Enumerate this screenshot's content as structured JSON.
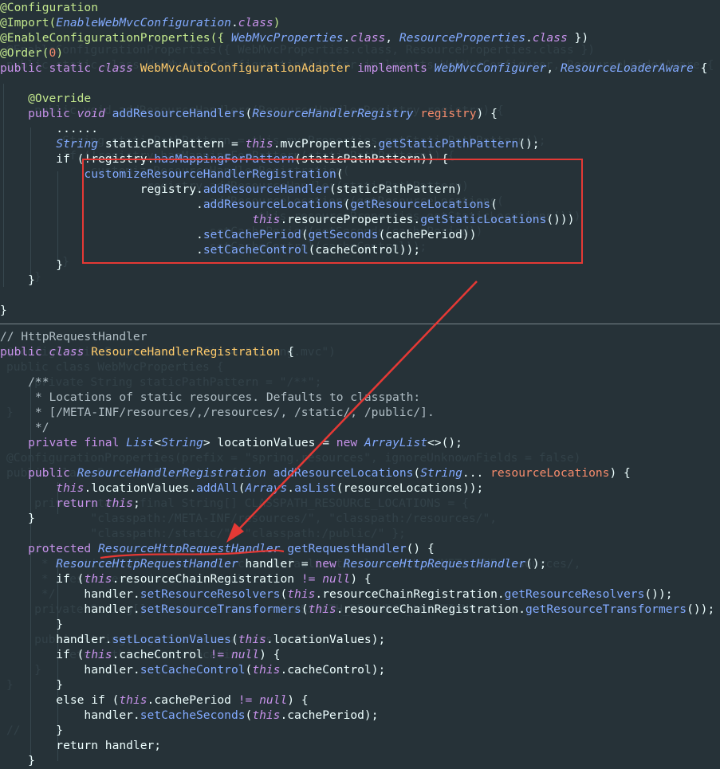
{
  "editor": {
    "top_pane": [
      [
        {
          "t": "@Configuration",
          "c": "annotation"
        }
      ],
      [
        {
          "t": "@Import(",
          "c": "annotation"
        },
        {
          "t": "EnableWebMvcConfiguration",
          "c": "type"
        },
        {
          "t": ".",
          "c": "default"
        },
        {
          "t": "class",
          "c": "italic"
        },
        {
          "t": ")",
          "c": "annotation"
        }
      ],
      [
        {
          "t": "@EnableConfigurationProperties({ ",
          "c": "annotation"
        },
        {
          "t": "WebMvcProperties",
          "c": "type"
        },
        {
          "t": ".",
          "c": "default"
        },
        {
          "t": "class",
          "c": "italic"
        },
        {
          "t": ", ",
          "c": "default"
        },
        {
          "t": "ResourceProperties",
          "c": "type"
        },
        {
          "t": ".",
          "c": "default"
        },
        {
          "t": "class",
          "c": "italic"
        },
        {
          "t": " })",
          "c": "default"
        }
      ],
      [
        {
          "t": "@Order(",
          "c": "annotation"
        },
        {
          "t": "0",
          "c": "number"
        },
        {
          "t": ")",
          "c": "annotation"
        }
      ],
      [
        {
          "t": "public static ",
          "c": "keyword"
        },
        {
          "t": "class ",
          "c": "italic"
        },
        {
          "t": "WebMvcAutoConfigurationAdapter ",
          "c": "class"
        },
        {
          "t": "implements ",
          "c": "keyword"
        },
        {
          "t": "WebMvcConfigurer",
          "c": "type"
        },
        {
          "t": ", ",
          "c": "default"
        },
        {
          "t": "ResourceLoaderAware ",
          "c": "type"
        },
        {
          "t": "{",
          "c": "default"
        }
      ],
      [],
      [
        {
          "t": "    @Override",
          "c": "annotation"
        }
      ],
      [
        {
          "t": "    public ",
          "c": "keyword"
        },
        {
          "t": "void ",
          "c": "italic"
        },
        {
          "t": "addResourceHandlers",
          "c": "method"
        },
        {
          "t": "(",
          "c": "default"
        },
        {
          "t": "ResourceHandlerRegistry ",
          "c": "type"
        },
        {
          "t": "registry",
          "c": "param"
        },
        {
          "t": ") {",
          "c": "default"
        }
      ],
      [
        {
          "t": "        ......",
          "c": "default"
        }
      ],
      [
        {
          "t": "        ",
          "c": "default"
        },
        {
          "t": "String ",
          "c": "type"
        },
        {
          "t": "staticPathPattern = ",
          "c": "default"
        },
        {
          "t": "this",
          "c": "italic"
        },
        {
          "t": ".mvcProperties.",
          "c": "default"
        },
        {
          "t": "getStaticPathPattern",
          "c": "method"
        },
        {
          "t": "();",
          "c": "default"
        }
      ],
      [
        {
          "t": "        if (!registry.",
          "c": "default"
        },
        {
          "t": "hasMappingForPattern",
          "c": "method"
        },
        {
          "t": "(staticPathPattern)) {",
          "c": "default"
        }
      ],
      [
        {
          "t": "            customizeResourceHandlerRegistration",
          "c": "method"
        },
        {
          "t": "(",
          "c": "default"
        }
      ],
      [
        {
          "t": "                    registry.",
          "c": "default"
        },
        {
          "t": "addResourceHandler",
          "c": "method"
        },
        {
          "t": "(staticPathPattern)",
          "c": "default"
        }
      ],
      [
        {
          "t": "                            .",
          "c": "default"
        },
        {
          "t": "addResourceLocations",
          "c": "method"
        },
        {
          "t": "(",
          "c": "default"
        },
        {
          "t": "getResourceLocations",
          "c": "method"
        },
        {
          "t": "(",
          "c": "default"
        }
      ],
      [
        {
          "t": "                                    ",
          "c": "default"
        },
        {
          "t": "this",
          "c": "italic"
        },
        {
          "t": ".resourceProperties.",
          "c": "default"
        },
        {
          "t": "getStaticLocations",
          "c": "method"
        },
        {
          "t": "()))",
          "c": "default"
        }
      ],
      [
        {
          "t": "                            .",
          "c": "default"
        },
        {
          "t": "setCachePeriod",
          "c": "method"
        },
        {
          "t": "(",
          "c": "default"
        },
        {
          "t": "getSeconds",
          "c": "method"
        },
        {
          "t": "(cachePeriod))",
          "c": "default"
        }
      ],
      [
        {
          "t": "                            .",
          "c": "default"
        },
        {
          "t": "setCacheControl",
          "c": "method"
        },
        {
          "t": "(cacheControl));",
          "c": "default"
        }
      ],
      [
        {
          "t": "        }",
          "c": "default"
        }
      ],
      [
        {
          "t": "    }",
          "c": "default"
        }
      ],
      [],
      [
        {
          "t": "}",
          "c": "default"
        }
      ]
    ],
    "bottom_pane": [
      [
        {
          "t": "// HttpRequestHandler",
          "c": "comment"
        }
      ],
      [
        {
          "t": "public ",
          "c": "keyword"
        },
        {
          "t": "class ",
          "c": "italic"
        },
        {
          "t": "ResourceHandlerRegistration ",
          "c": "class"
        },
        {
          "t": "{",
          "c": "default"
        }
      ],
      [],
      [
        {
          "t": "    /**",
          "c": "comment"
        }
      ],
      [
        {
          "t": "     * Locations of static resources. Defaults to classpath:",
          "c": "comment"
        }
      ],
      [
        {
          "t": "     * [/META-INF/resources/,/resources/, /static/, /public/].",
          "c": "comment"
        }
      ],
      [
        {
          "t": "     */",
          "c": "comment"
        }
      ],
      [
        {
          "t": "    private final ",
          "c": "keyword"
        },
        {
          "t": "List",
          "c": "type"
        },
        {
          "t": "<",
          "c": "default"
        },
        {
          "t": "String",
          "c": "type"
        },
        {
          "t": "> ",
          "c": "default"
        },
        {
          "t": "locationValues = ",
          "c": "default"
        },
        {
          "t": "new ",
          "c": "keyword"
        },
        {
          "t": "ArrayList",
          "c": "type"
        },
        {
          "t": "<>();",
          "c": "default"
        }
      ],
      [],
      [
        {
          "t": "    public ",
          "c": "keyword"
        },
        {
          "t": "ResourceHandlerRegistration ",
          "c": "type"
        },
        {
          "t": "addResourceLocations",
          "c": "method"
        },
        {
          "t": "(",
          "c": "default"
        },
        {
          "t": "String",
          "c": "type"
        },
        {
          "t": "... ",
          "c": "default"
        },
        {
          "t": "resourceLocations",
          "c": "param"
        },
        {
          "t": ") {",
          "c": "default"
        }
      ],
      [
        {
          "t": "        ",
          "c": "default"
        },
        {
          "t": "this",
          "c": "italic"
        },
        {
          "t": ".locationValues.",
          "c": "default"
        },
        {
          "t": "addAll",
          "c": "method"
        },
        {
          "t": "(",
          "c": "default"
        },
        {
          "t": "Arrays",
          "c": "type"
        },
        {
          "t": ".",
          "c": "default"
        },
        {
          "t": "asList",
          "c": "method"
        },
        {
          "t": "(resourceLocations));",
          "c": "default"
        }
      ],
      [
        {
          "t": "        return ",
          "c": "keyword"
        },
        {
          "t": "this",
          "c": "italic"
        },
        {
          "t": ";",
          "c": "default"
        }
      ],
      [
        {
          "t": "    }",
          "c": "default"
        }
      ],
      [],
      [
        {
          "t": "    protected ",
          "c": "keyword"
        },
        {
          "t": "ResourceHttpRequestHandler",
          "c": "type"
        },
        {
          "t": " ",
          "c": "default"
        },
        {
          "t": "getRequestHandler",
          "c": "method"
        },
        {
          "t": "() {",
          "c": "default"
        }
      ],
      [
        {
          "t": "        ",
          "c": "default"
        },
        {
          "t": "ResourceHttpRequestHandler ",
          "c": "type"
        },
        {
          "t": "handler = ",
          "c": "default"
        },
        {
          "t": "new ",
          "c": "keyword"
        },
        {
          "t": "ResourceHttpRequestHandler",
          "c": "type"
        },
        {
          "t": "();",
          "c": "default"
        }
      ],
      [
        {
          "t": "        if (",
          "c": "default"
        },
        {
          "t": "this",
          "c": "italic"
        },
        {
          "t": ".resourceChainRegistration ",
          "c": "default"
        },
        {
          "t": "!= ",
          "c": "keyword"
        },
        {
          "t": "null",
          "c": "italic"
        },
        {
          "t": ") {",
          "c": "default"
        }
      ],
      [
        {
          "t": "            handler.",
          "c": "default"
        },
        {
          "t": "setResourceResolvers",
          "c": "method"
        },
        {
          "t": "(",
          "c": "default"
        },
        {
          "t": "this",
          "c": "italic"
        },
        {
          "t": ".resourceChainRegistration.",
          "c": "default"
        },
        {
          "t": "getResourceResolvers",
          "c": "method"
        },
        {
          "t": "());",
          "c": "default"
        }
      ],
      [
        {
          "t": "            handler.",
          "c": "default"
        },
        {
          "t": "setResourceTransformers",
          "c": "method"
        },
        {
          "t": "(",
          "c": "default"
        },
        {
          "t": "this",
          "c": "italic"
        },
        {
          "t": ".resourceChainRegistration.",
          "c": "default"
        },
        {
          "t": "getResourceTransformers",
          "c": "method"
        },
        {
          "t": "());",
          "c": "default"
        }
      ],
      [
        {
          "t": "        }",
          "c": "default"
        }
      ],
      [
        {
          "t": "        handler.",
          "c": "default"
        },
        {
          "t": "setLocationValues",
          "c": "method"
        },
        {
          "t": "(",
          "c": "default"
        },
        {
          "t": "this",
          "c": "italic"
        },
        {
          "t": ".locationValues);",
          "c": "default"
        }
      ],
      [
        {
          "t": "        if (",
          "c": "default"
        },
        {
          "t": "this",
          "c": "italic"
        },
        {
          "t": ".cacheControl ",
          "c": "default"
        },
        {
          "t": "!= ",
          "c": "keyword"
        },
        {
          "t": "null",
          "c": "italic"
        },
        {
          "t": ") {",
          "c": "default"
        }
      ],
      [
        {
          "t": "            handler.",
          "c": "default"
        },
        {
          "t": "setCacheControl",
          "c": "method"
        },
        {
          "t": "(",
          "c": "default"
        },
        {
          "t": "this",
          "c": "italic"
        },
        {
          "t": ".cacheControl);",
          "c": "default"
        }
      ],
      [
        {
          "t": "        }",
          "c": "default"
        }
      ],
      [
        {
          "t": "        else if (",
          "c": "default"
        },
        {
          "t": "this",
          "c": "italic"
        },
        {
          "t": ".cachePeriod ",
          "c": "default"
        },
        {
          "t": "!= ",
          "c": "keyword"
        },
        {
          "t": "null",
          "c": "italic"
        },
        {
          "t": ") {",
          "c": "default"
        }
      ],
      [
        {
          "t": "            handler.",
          "c": "default"
        },
        {
          "t": "setCacheSeconds",
          "c": "method"
        },
        {
          "t": "(",
          "c": "default"
        },
        {
          "t": "this",
          "c": "italic"
        },
        {
          "t": ".cachePeriod);",
          "c": "default"
        }
      ],
      [
        {
          "t": "        }",
          "c": "default"
        }
      ],
      [
        {
          "t": "        return handler;",
          "c": "default"
        }
      ],
      [
        {
          "t": "    }",
          "c": "default"
        }
      ]
    ],
    "ghost_top": [
      "@EnableConfigurationProperties({ WebMvcProperties.class, ResourceProperties.class })",
      "public static class WebMvcAutoConfigurationAdapter implements WebMvcConfigurer, ResourceLoaderAware {",
      "",
      "",
      "    public void addResourceHandlers(ResourceHandlerRegistry registry) {",
      "",
      "        String staticPathPattern = this.mvcProperties.getStaticPathPattern();",
      "        if (!registry.hasMappingForPattern(staticPathPattern)) {",
      "            customizeResourceHandlerRegistration(",
      "                    registry.addResourceHandler(staticPathPattern)",
      "                            .addResourceLocations(getResourceLocations(",
      "                                    this.resourceProperties.getStaticLocations()))",
      "                            .setCachePeriod(getSeconds(cachePeriod))",
      "                            .setCacheControl(cacheControl));",
      "        }",
      "    }"
    ],
    "ghost_bottom": [
      "@ConfigurationProperties(prefix = \"spring.mvc\")",
      "public class WebMvcProperties {",
      "    private String staticPathPattern = \"/**\";",
      "",
      "}",
      "",
      "",
      "@ConfigurationProperties(prefix = \"spring.resources\", ignoreUnknownFields = false)",
      "public class ResourceProperties {",
      "",
      "    private static final String[] CLASSPATH_RESOURCE_LOCATIONS = {",
      "            \"classpath:/META-INF/resources/\", \"classpath:/resources/\",",
      "            \"classpath:/static/\", \"classpath:/public/\" };",
      "    /**",
      "     * Locations of static resources. Defaults to classpath:[/META-INF/resources/,",
      "     * /resources/, /static/, /public/].",
      "     */",
      "    private String[] staticLocations = CLASSPATH_RESOURCE_LOCATIONS;",
      "",
      "    public String[] getStaticLocations() {",
      "        return this.staticLocations;",
      "    }",
      "}",
      "",
      "",
      "//"
    ],
    "colors": {
      "background": "#263238",
      "highlight_box": "#E53935",
      "arrow": "#E53935"
    }
  }
}
